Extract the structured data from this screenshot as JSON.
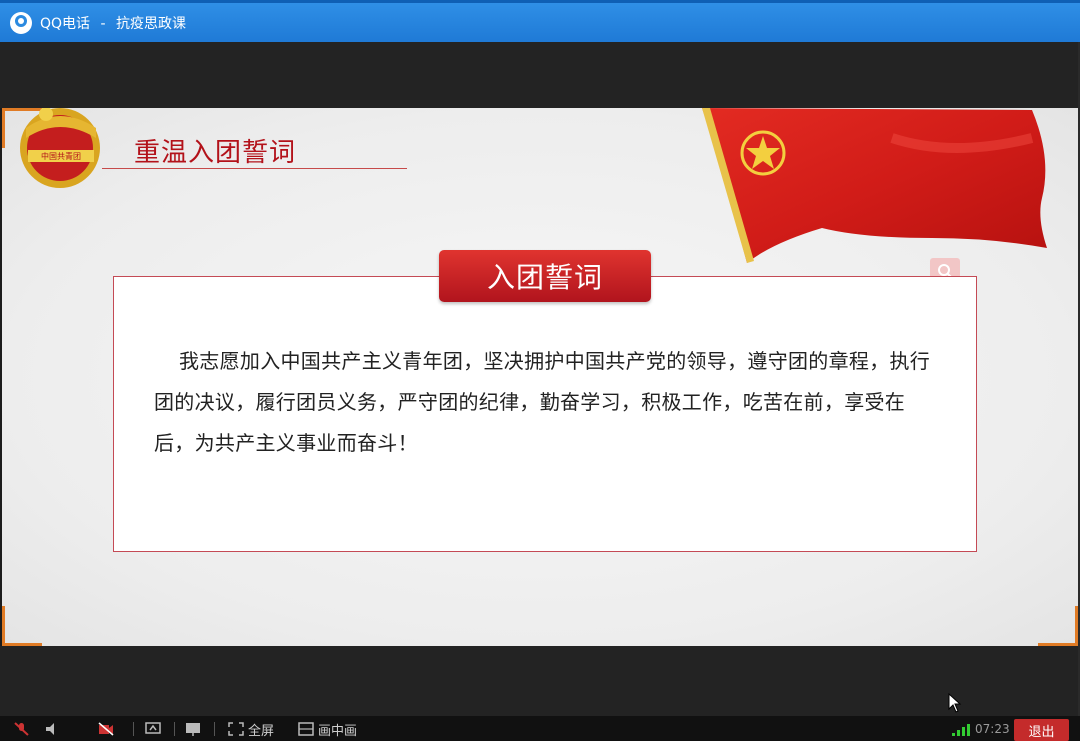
{
  "window": {
    "app_name": "QQ电话",
    "separator": "-",
    "session": "抗疫思政课"
  },
  "slide": {
    "heading": "重温入团誓词",
    "oath_title": "入团誓词",
    "oath_text": "我志愿加入中国共产主义青年团，坚决拥护中国共产党的领导，遵守团的章程，执行团的决议，履行团员义务，严守团的纪律，勤奋学习，积极工作，吃苦在前，享受在后，为共产主义事业而奋斗！",
    "emblem_text": "中国共青团"
  },
  "toolbar": {
    "fullscreen_label": "全屏",
    "pip_label": "画中画",
    "time": "07:23",
    "exit_label": "退出"
  },
  "colors": {
    "accent": "#1f7ad6",
    "brand_red": "#c42b2b",
    "heading_red": "#b3121a"
  }
}
